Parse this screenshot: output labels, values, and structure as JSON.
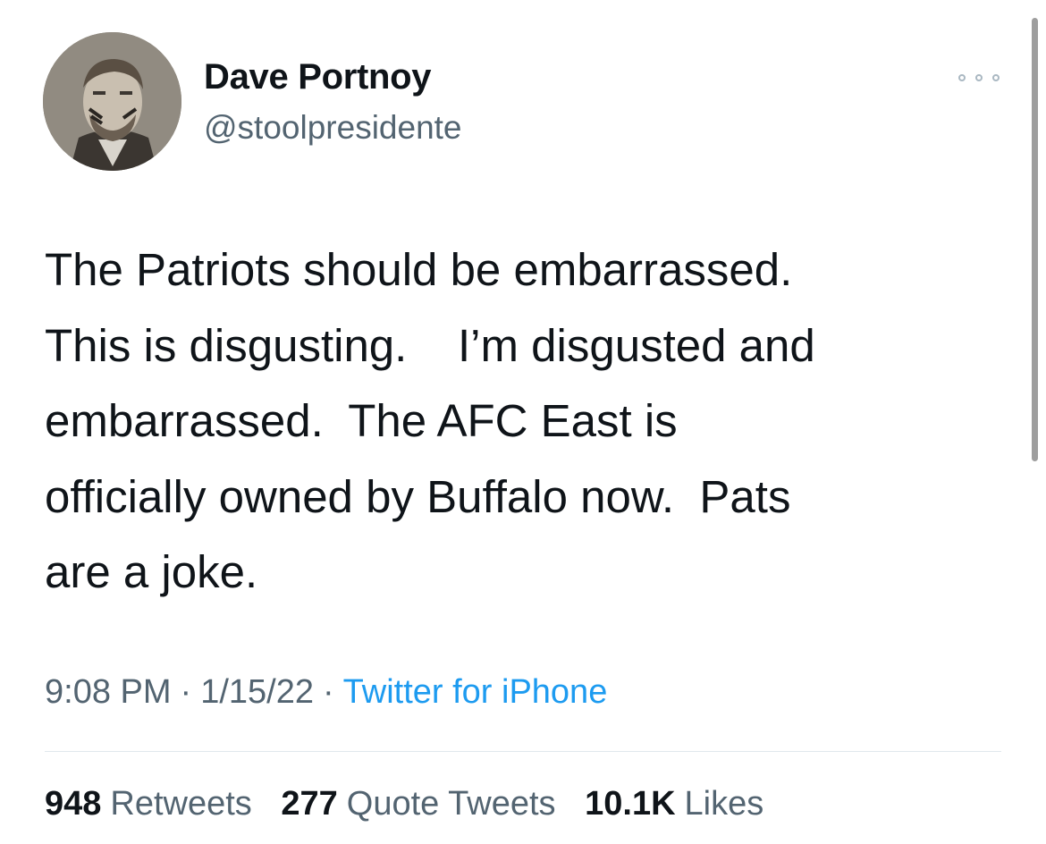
{
  "author": {
    "display_name": "Dave Portnoy",
    "handle": "@stoolpresidente",
    "avatar_icon": "profile-photo"
  },
  "more_icon": "ellipsis-icon",
  "tweet": {
    "text": "The Patriots should be embarrassed.  \nThis is disgusting.    I’m disgusted and \nembarrassed.  The AFC East is \nofficially owned by Buffalo now.  Pats \nare a joke."
  },
  "meta": {
    "time": "9:08 PM",
    "separator": "·",
    "date": "1/15/22",
    "source": "Twitter for iPhone"
  },
  "stats": {
    "retweets_count": "948",
    "retweets_label": "Retweets",
    "quotes_count": "277",
    "quotes_label": "Quote Tweets",
    "likes_count": "10.1K",
    "likes_label": "Likes"
  },
  "colors": {
    "text_primary": "#0f1419",
    "text_secondary": "#536471",
    "link": "#1d9bf0",
    "divider": "#e1e8ed"
  }
}
